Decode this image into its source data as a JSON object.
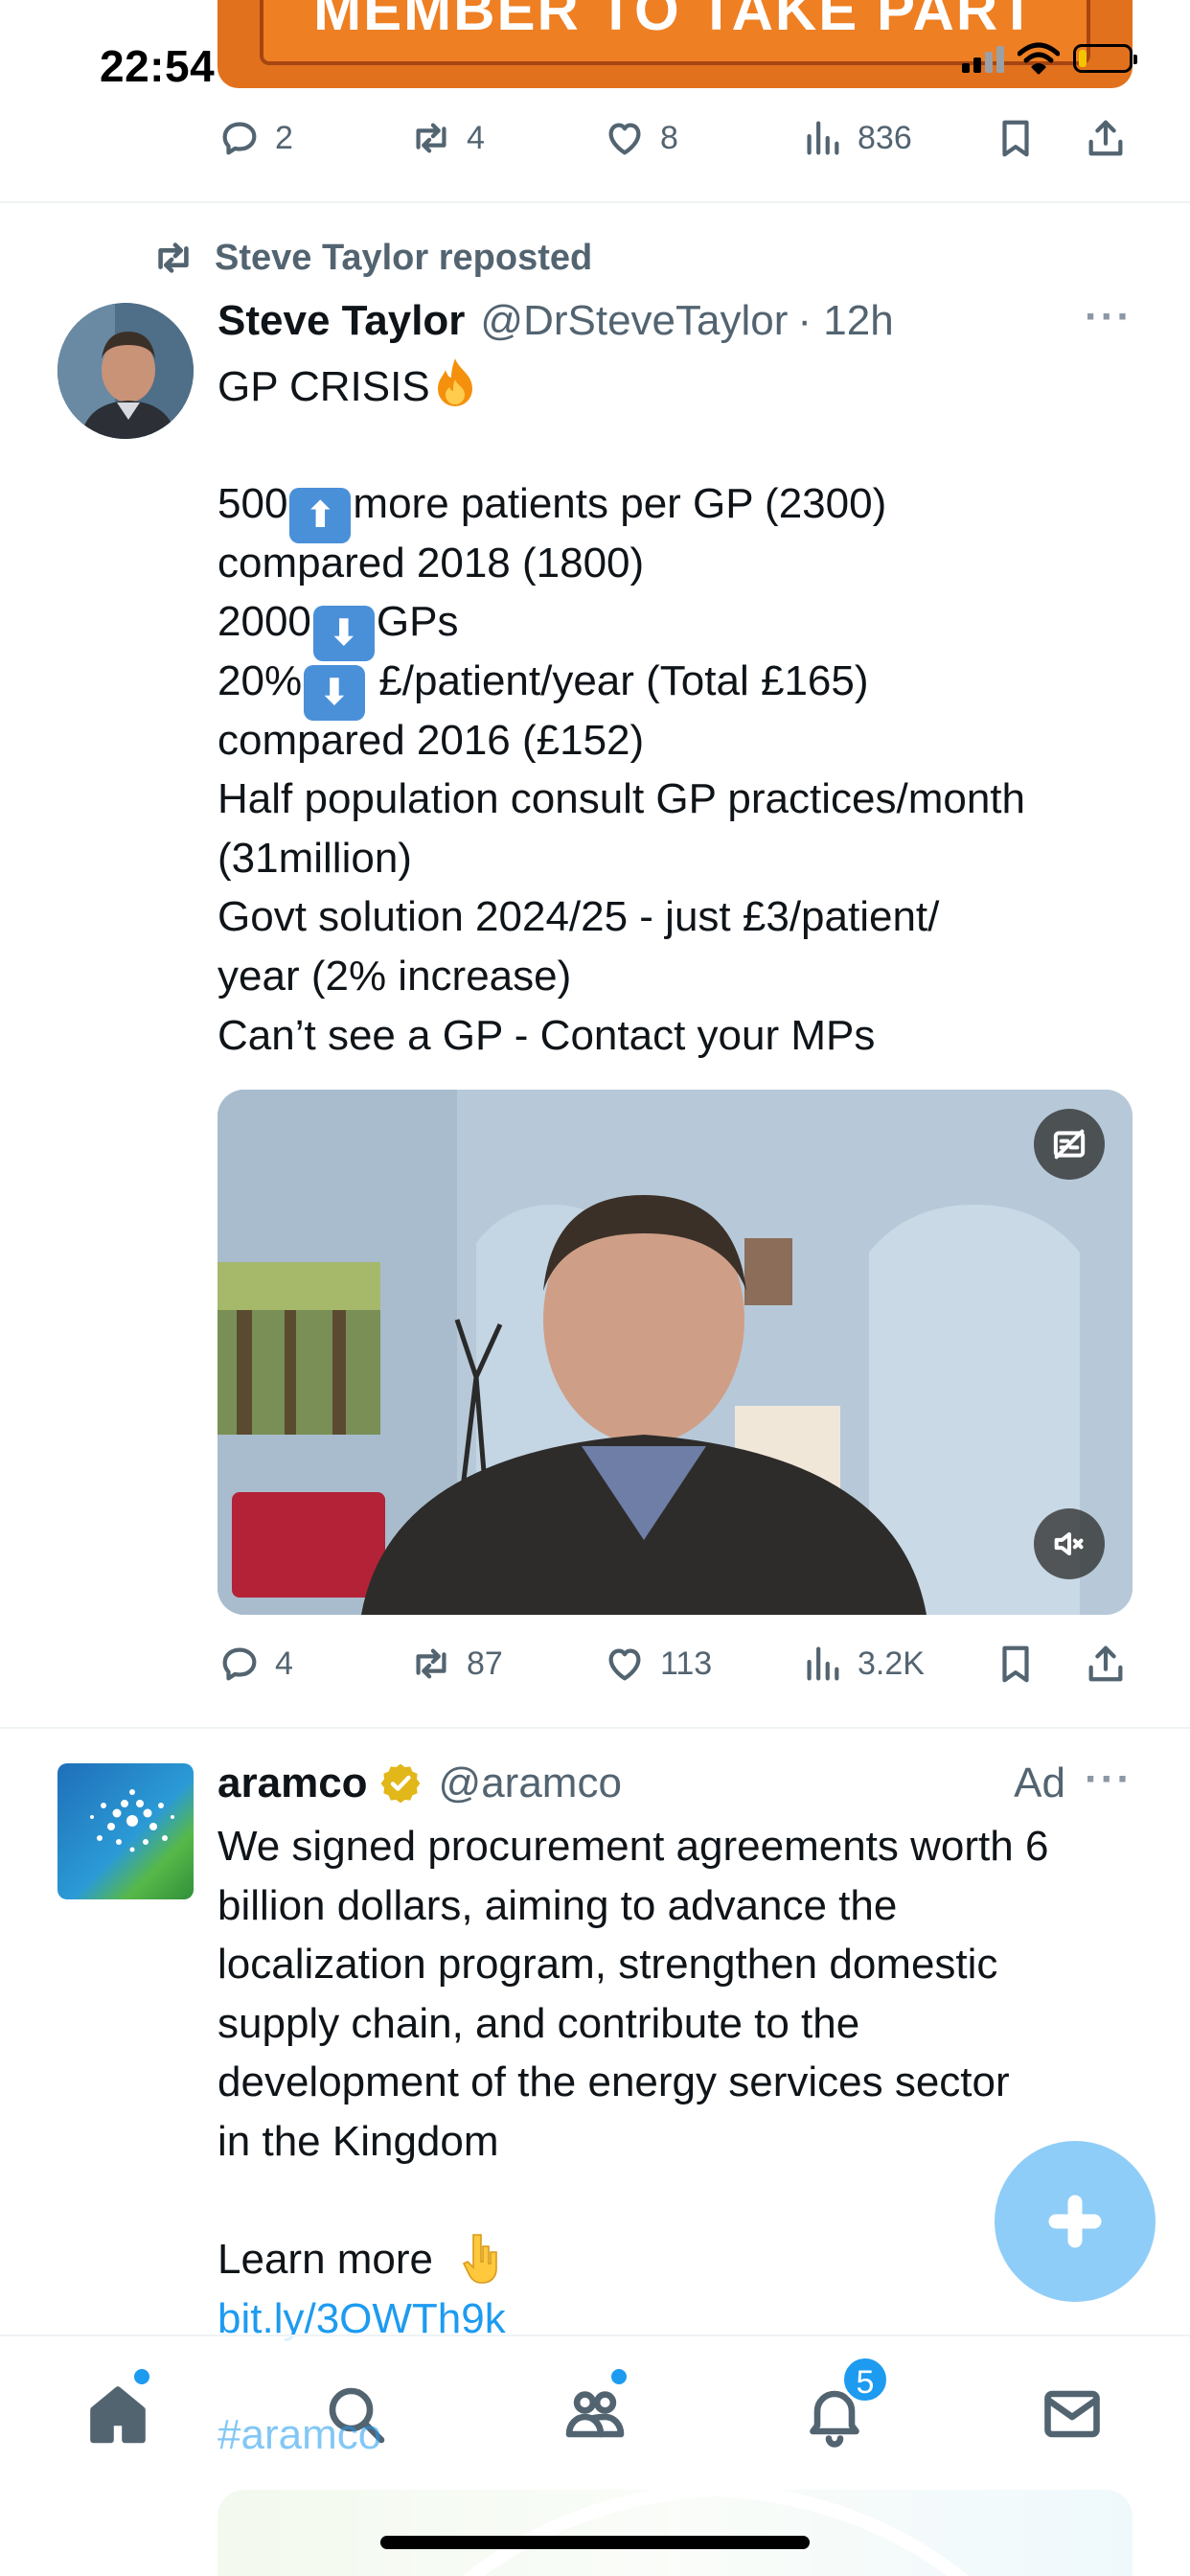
{
  "status_bar": {
    "time": "22:54"
  },
  "previous_tweet": {
    "banner_text": "MEMBER TO TAKE PART",
    "reply_count": "2",
    "repost_count": "4",
    "like_count": "8",
    "view_count": "836"
  },
  "tweet": {
    "repost_label": "Steve Taylor reposted",
    "author_name": "Steve Taylor",
    "author_handle": "@DrSteveTaylor",
    "time": "· 12h",
    "line1": "GP CRISIS",
    "line2_a": "500",
    "line2_b": "more patients per GP (2300)",
    "line3": "compared 2018 (1800)",
    "line4_a": "2000",
    "line4_b": "GPs",
    "line5_a": "20%",
    "line5_b": " £/patient/year (Total £165)",
    "line6": "compared 2016 (£152)",
    "line7": "Half population consult GP practices/month",
    "line8": "(31million)",
    "line9": "Govt solution 2024/25 - just £3/patient/",
    "line10": "year (2% increase)",
    "line11": "Can’t see a GP - Contact your MPs",
    "reply_count": "4",
    "repost_count": "87",
    "like_count": "113",
    "view_count": "3.2K"
  },
  "ad_tweet": {
    "author_name": "aramco",
    "author_handle": "@aramco",
    "ad_label": "Ad",
    "line1": "We signed procurement agreements worth 6",
    "line2": "billion dollars, aiming to advance the",
    "line3": "localization program, strengthen domestic",
    "line4": "supply chain, and contribute to the",
    "line5": "development of the energy services sector",
    "line6": "in the Kingdom",
    "learn_more": "Learn more",
    "link": "bit.ly/3OWTh9k",
    "hashtag": "#aramco"
  },
  "bottom_nav": {
    "notification_badge": "5"
  },
  "colors": {
    "accent": "#1d9bf0",
    "text_secondary": "#536471",
    "fab": "#8ecdf7"
  }
}
